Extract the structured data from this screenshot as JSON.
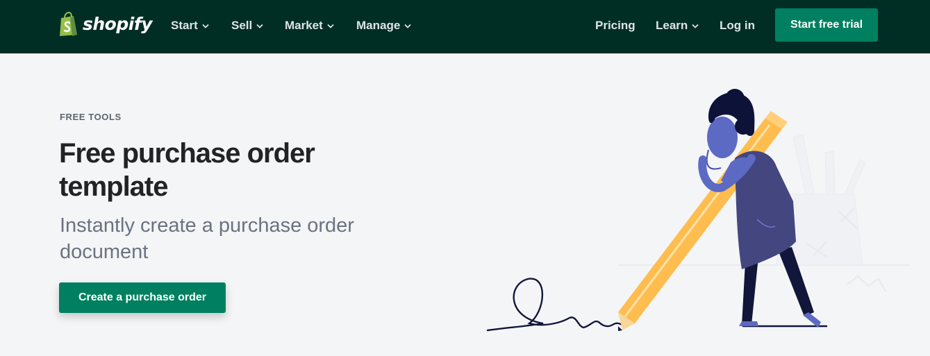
{
  "nav": {
    "brand": "shopify",
    "menu": [
      {
        "label": "Start",
        "dropdown": true
      },
      {
        "label": "Sell",
        "dropdown": true
      },
      {
        "label": "Market",
        "dropdown": true
      },
      {
        "label": "Manage",
        "dropdown": true
      }
    ],
    "right": [
      {
        "label": "Pricing",
        "dropdown": false
      },
      {
        "label": "Learn",
        "dropdown": true
      },
      {
        "label": "Log in",
        "dropdown": false
      }
    ],
    "cta_label": "Start free trial"
  },
  "hero": {
    "eyebrow": "FREE TOOLS",
    "title": "Free purchase order template",
    "subtitle": "Instantly create a purchase order document",
    "cta_label": "Create a purchase order"
  },
  "colors": {
    "nav_bg": "#002e25",
    "brand_green": "#008060",
    "page_bg": "#f4f5f7",
    "pencil": "#ffbd4f",
    "figure": "#5c6ac4",
    "dress": "#43467f",
    "hair": "#0d1238"
  },
  "icons": [
    "shopify-bag-icon",
    "chevron-down-icon",
    "pencil-person-illustration"
  ]
}
